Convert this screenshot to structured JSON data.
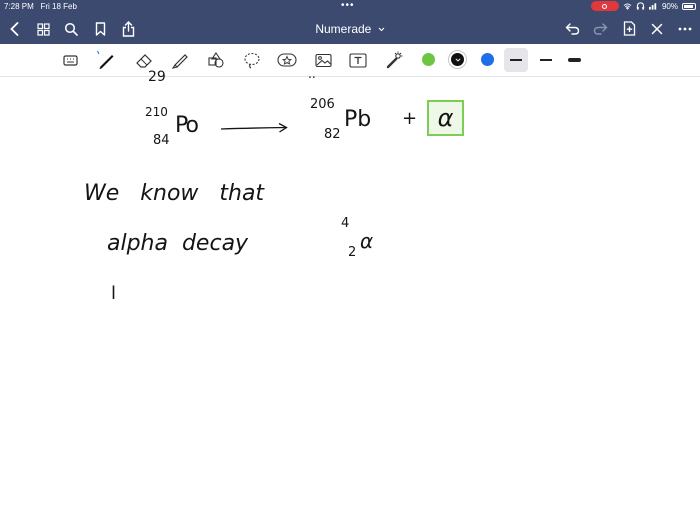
{
  "status": {
    "time": "7:28 PM",
    "date": "Fri 18 Feb",
    "battery": "90%"
  },
  "nav": {
    "title": "Numerade",
    "back_icon": "chevron-left-icon",
    "grid_icon": "grid-icon",
    "search_icon": "search-icon",
    "bookmark_icon": "bookmark-icon",
    "share_icon": "share-icon",
    "undo_icon": "undo-icon",
    "redo_icon": "redo-icon",
    "add_page_icon": "add-page-icon",
    "close_icon": "close-icon"
  },
  "toolbar": {
    "tools": [
      "keyboard",
      "pen",
      "eraser",
      "highlighter",
      "shapes",
      "lasso",
      "sticker",
      "image",
      "text",
      "laser"
    ],
    "colors": [
      "#6cc644",
      "#111111",
      "#1e6ee8"
    ]
  },
  "note": {
    "top_fragment_left": "29",
    "top_fragment_right": "..",
    "reactant_mass": "210",
    "reactant_atomic": "84",
    "reactant_symbol": "Po",
    "product_mass": "206",
    "product_atomic": "82",
    "product_symbol": "Pb",
    "plus": "+",
    "boxed_answer": "α",
    "line1": "We   know   that",
    "line2": "alpha  decay",
    "alpha_mass": "4",
    "alpha_atomic": "2",
    "alpha_symbol": "α",
    "line3": "l"
  }
}
